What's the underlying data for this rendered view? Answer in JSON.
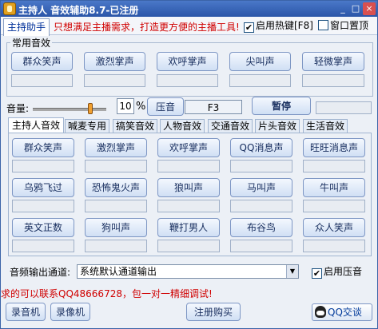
{
  "window": {
    "title": "主持人 音效辅助8.7-已注册",
    "min_icon": "minimize-icon",
    "max_icon": "maximize-icon",
    "close_icon": "close-icon"
  },
  "top": {
    "host_tab": "主持助手",
    "slogan": "只想满足主播需求，打造更方便的主播工具!",
    "hotkey_checked": true,
    "hotkey_label": "启用热键[F8]",
    "ontop_checked": false,
    "ontop_label": "窗口置顶"
  },
  "common": {
    "title": "常用音效",
    "buttons": [
      "群众笑声",
      "激烈掌声",
      "欢呼掌声",
      "尖叫声",
      "轻微掌声"
    ]
  },
  "volume": {
    "label": "音量:",
    "level_percent": 80,
    "value": "10",
    "unit": "%",
    "compress_label": "压音",
    "hotkey_field": "F3",
    "pause_label": "暂停"
  },
  "tabs": [
    "主持人音效",
    "喊麦专用",
    "搞笑音效",
    "人物音效",
    "交通音效",
    "片头音效",
    "生活音效"
  ],
  "active_tab": 0,
  "sounds": {
    "row1": [
      "群众笑声",
      "激烈掌声",
      "欢呼掌声",
      "QQ消息声",
      "旺旺消息声"
    ],
    "row2": [
      "乌鸦飞过",
      "恐怖鬼火声",
      "狼叫声",
      "马叫声",
      "牛叫声"
    ],
    "row3": [
      "英文正数",
      "狗叫声",
      "鞭打男人",
      "布谷鸟",
      "众人笑声"
    ]
  },
  "output": {
    "label": "音频输出通道:",
    "selected": "系统默认通道输出",
    "compress_checked": true,
    "compress_label": "启用压音"
  },
  "contact": "求的可以联系QQ48666728，包一对一精细调试!",
  "footer": {
    "recorder": "录音机",
    "camera": "录像机",
    "register": "注册购买",
    "qq_label": "QQ交谈"
  }
}
